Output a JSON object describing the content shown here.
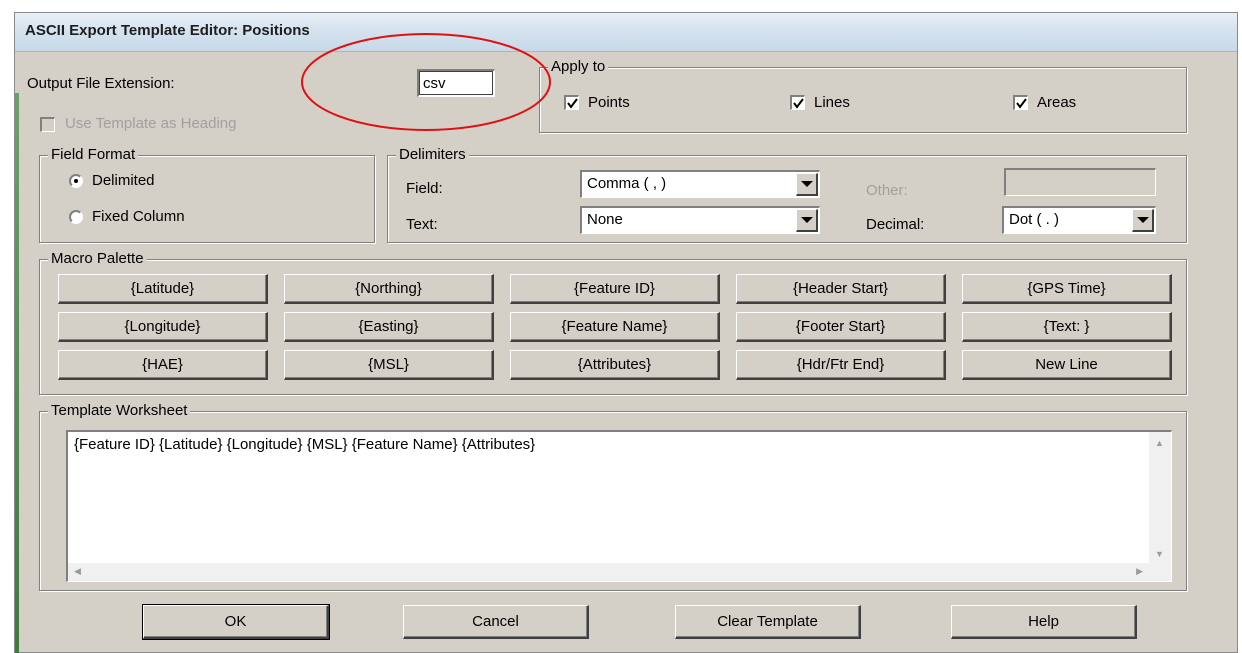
{
  "window": {
    "title": "ASCII Export Template Editor: Positions"
  },
  "output": {
    "label": "Output File Extension:",
    "value": "csv",
    "use_template_label": "Use Template as Heading"
  },
  "apply_to": {
    "label": "Apply to",
    "points": "Points",
    "lines": "Lines",
    "areas": "Areas"
  },
  "field_format": {
    "label": "Field Format",
    "delimited": "Delimited",
    "fixed": "Fixed Column"
  },
  "delimiters": {
    "label": "Delimiters",
    "field_label": "Field:",
    "field_value": "Comma ( , )",
    "text_label": "Text:",
    "text_value": "None",
    "other_label": "Other:",
    "decimal_label": "Decimal:",
    "decimal_value": "Dot ( . )"
  },
  "macro": {
    "label": "Macro Palette",
    "buttons": [
      "{Latitude}",
      "{Northing}",
      "{Feature ID}",
      "{Header Start}",
      "{GPS Time}",
      "{Longitude}",
      "{Easting}",
      "{Feature Name}",
      "{Footer Start}",
      "{Text: }",
      "{HAE}",
      "{MSL}",
      "{Attributes}",
      "{Hdr/Ftr End}",
      "New Line"
    ]
  },
  "worksheet": {
    "label": "Template Worksheet",
    "content": "{Feature ID}  {Latitude} {Longitude}  {MSL}  {Feature Name} {Attributes}"
  },
  "footer": {
    "ok": "OK",
    "cancel": "Cancel",
    "clear": "Clear Template",
    "help": "Help"
  },
  "annotation": {
    "color": "#e01010"
  }
}
